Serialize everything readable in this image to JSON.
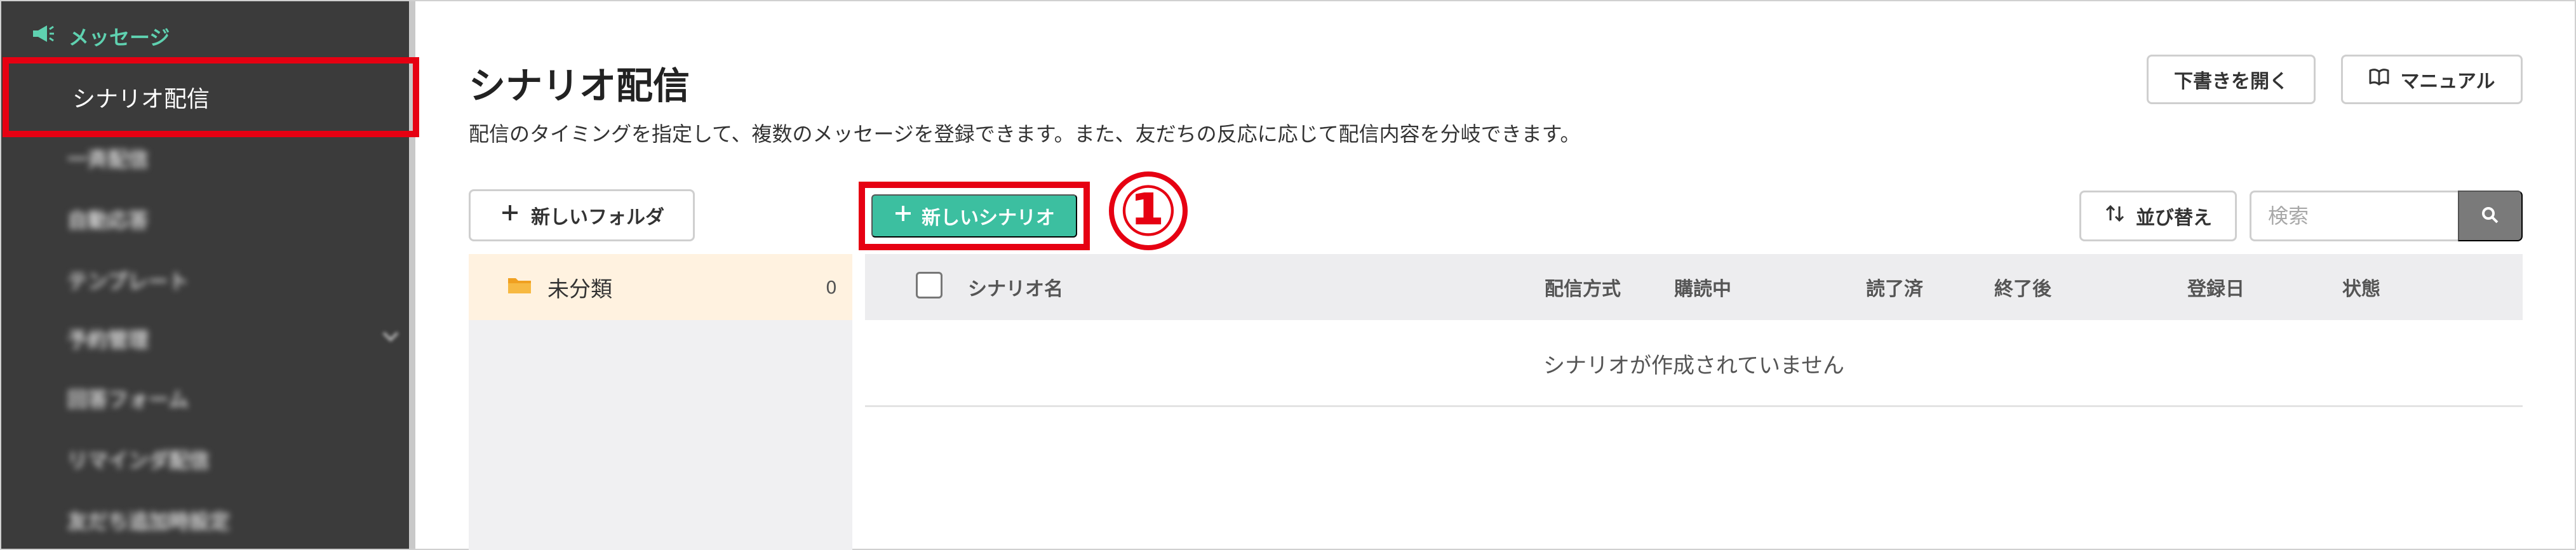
{
  "sidebar": {
    "section_label": "メッセージ",
    "active_item": "シナリオ配信",
    "items": [
      {
        "label": "一斉配信"
      },
      {
        "label": "自動応答"
      },
      {
        "label": "テンプレート"
      },
      {
        "label": "予約管理"
      },
      {
        "label": "回答フォーム"
      },
      {
        "label": "リマインダ配信"
      },
      {
        "label": "友だち追加時設定"
      }
    ]
  },
  "page": {
    "title": "シナリオ配信",
    "description": "配信のタイミングを指定して、複数のメッセージを登録できます。また、友だちの反応に応じて配信内容を分岐できます。"
  },
  "header_buttons": {
    "draft": "下書きを開く",
    "manual": "マニュアル"
  },
  "toolbar": {
    "new_folder": "新しいフォルダ",
    "new_scenario": "新しいシナリオ",
    "step_marker": "①",
    "sort": "並び替え",
    "search_placeholder": "検索"
  },
  "folders": [
    {
      "name": "未分類",
      "count": "0"
    }
  ],
  "table": {
    "columns": [
      "シナリオ名",
      "配信方式",
      "購読中",
      "読了済",
      "終了後",
      "登録日",
      "状態"
    ],
    "empty_message": "シナリオが作成されていません"
  },
  "colors": {
    "accent": "#3cbfa0",
    "highlight": "#e60012",
    "sidebar_bg": "#3b3b3b",
    "sidebar_section": "#5fd1b0"
  }
}
